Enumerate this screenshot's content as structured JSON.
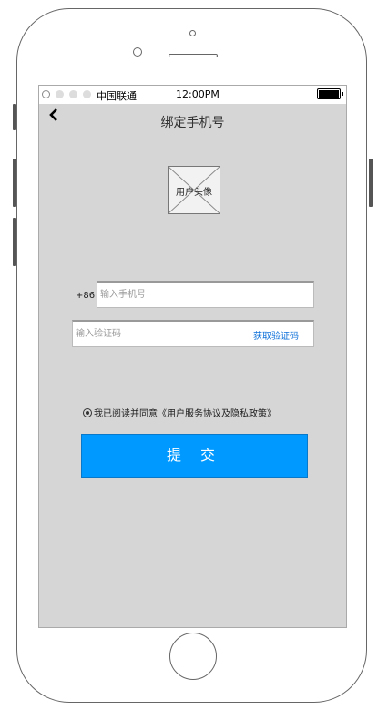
{
  "status_bar": {
    "carrier": "中国联通",
    "time": "12:00PM",
    "signal_dots": [
      "empty",
      "filled",
      "filled",
      "filled"
    ],
    "battery_level": 1.0
  },
  "header": {
    "back_icon": "chevron-left-icon",
    "title": "绑定手机号"
  },
  "avatar": {
    "label": "用户头像"
  },
  "phone_field": {
    "country_code": "+86",
    "placeholder": "输入手机号",
    "value": ""
  },
  "code_field": {
    "placeholder": "输入验证码",
    "value": "",
    "get_code_label": "获取验证码"
  },
  "agreement": {
    "checked": true,
    "text": "我已阅读并同意《用户服务协议及隐私政策》"
  },
  "submit_button": {
    "label": "提 交"
  },
  "colors": {
    "accent": "#0099ff",
    "link": "#0c6fd9",
    "screen_background": "#d6d6d6"
  }
}
